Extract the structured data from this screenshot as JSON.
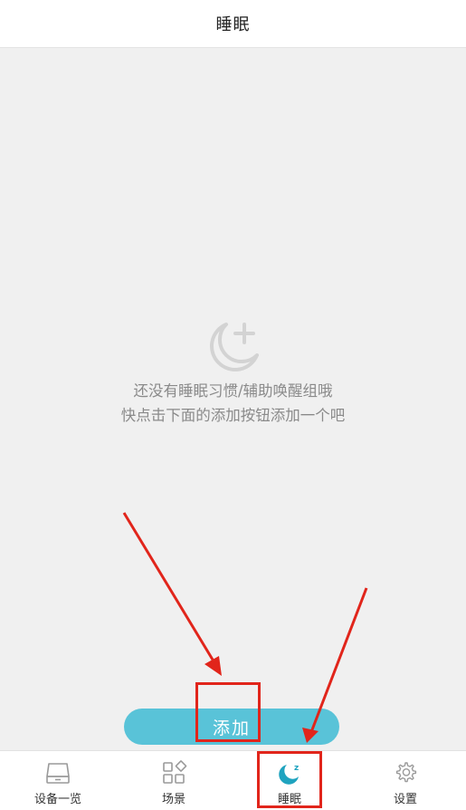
{
  "header": {
    "title": "睡眠"
  },
  "empty_state": {
    "icon": "moon-plus-icon",
    "line1": "还没有睡眠习惯/辅助唤醒组哦",
    "line2": "快点击下面的添加按钮添加一个吧"
  },
  "add_button": {
    "label": "添加"
  },
  "tabbar": {
    "items": [
      {
        "label": "设备一览",
        "icon": "device-list-icon",
        "active": false
      },
      {
        "label": "场景",
        "icon": "scene-grid-icon",
        "active": false
      },
      {
        "label": "睡眠",
        "icon": "sleep-moon-icon",
        "active": true
      },
      {
        "label": "设置",
        "icon": "gear-icon",
        "active": false
      }
    ]
  },
  "colors": {
    "accent": "#59c3d8",
    "active_icon": "#1fa3bf",
    "background": "#f0f0f0",
    "annotation": "#e1251b"
  }
}
